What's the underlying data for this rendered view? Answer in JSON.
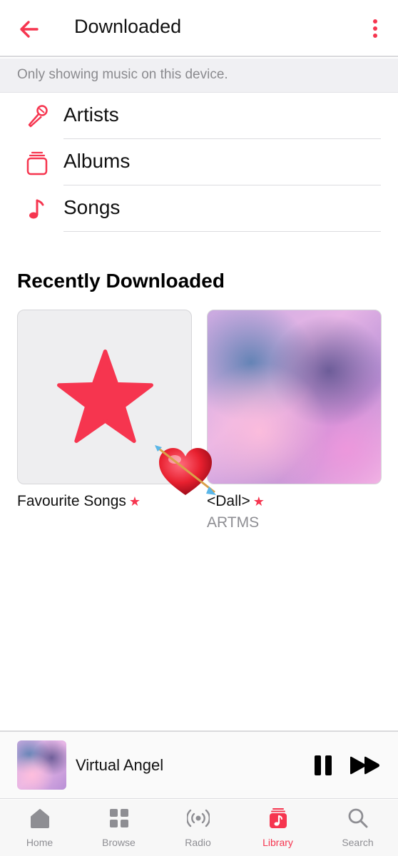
{
  "header": {
    "title": "Downloaded"
  },
  "banner": {
    "text": "Only showing music on this device."
  },
  "nav": {
    "items": [
      {
        "label": "Artists",
        "icon": "microphone-icon"
      },
      {
        "label": "Albums",
        "icon": "album-stack-icon"
      },
      {
        "label": "Songs",
        "icon": "music-note-icon"
      }
    ]
  },
  "recent": {
    "title": "Recently Downloaded",
    "cards": [
      {
        "title": "Favourite Songs",
        "badge": "★",
        "subtitle": ""
      },
      {
        "title": "<Dall>",
        "badge": "★",
        "subtitle": "ARTMS"
      }
    ]
  },
  "mini_player": {
    "title": "Virtual Angel"
  },
  "tabs": [
    {
      "label": "Home",
      "icon": "home-icon",
      "active": false
    },
    {
      "label": "Browse",
      "icon": "grid-icon",
      "active": false
    },
    {
      "label": "Radio",
      "icon": "radio-icon",
      "active": false
    },
    {
      "label": "Library",
      "icon": "library-icon",
      "active": true
    },
    {
      "label": "Search",
      "icon": "search-icon",
      "active": false
    }
  ],
  "colors": {
    "accent": "#f6354f",
    "secondary_text": "#8e8e93"
  }
}
